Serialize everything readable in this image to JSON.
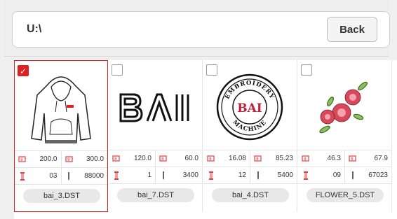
{
  "path": {
    "value": "U:\\"
  },
  "back_button": {
    "label": "Back"
  },
  "files": [
    {
      "name": "bai_3.DST",
      "width": "200.0",
      "height": "300.0",
      "colors": "03",
      "stitches": "88000",
      "selected": true
    },
    {
      "name": "bai_7.DST",
      "width": "120.0",
      "height": "60.0",
      "colors": "1",
      "stitches": "3400",
      "selected": false
    },
    {
      "name": "bai_4.DST",
      "width": "16.08",
      "height": "85.23",
      "colors": "12",
      "stitches": "5400",
      "selected": false
    },
    {
      "name": "FLOWER_5.DST",
      "width": "46.3",
      "height": "67.9",
      "colors": "09",
      "stitches": "67023",
      "selected": false
    }
  ],
  "badge": {
    "ring_top": "EMBROIDERY",
    "center": "BAI",
    "ring_bottom": "MACHINE"
  },
  "colors": {
    "accent": "#e02020",
    "icon_red": "#e04040"
  }
}
